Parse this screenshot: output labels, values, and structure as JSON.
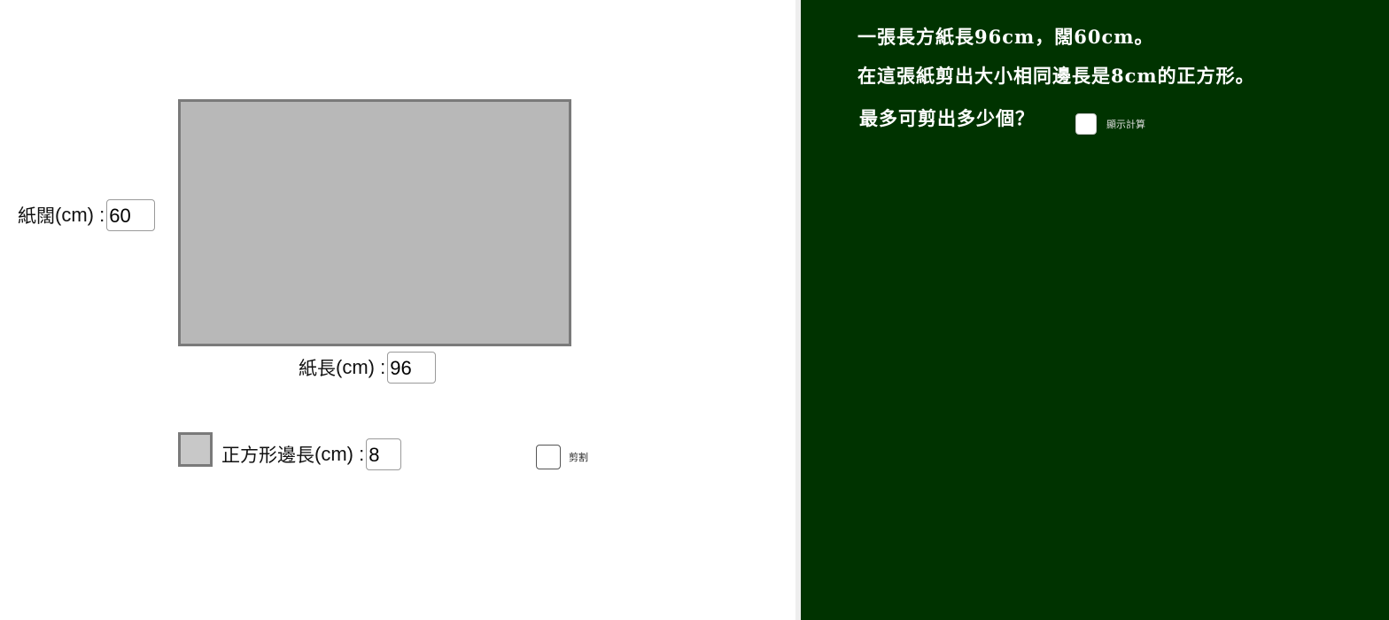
{
  "canvas": {
    "paper_width_label": "紙闊",
    "paper_width_unit": "(cm) :",
    "paper_width_value": "60",
    "paper_length_label": "紙長",
    "paper_length_unit": "(cm) :",
    "paper_length_value": "96",
    "square_side_label": "正方形邊長",
    "square_side_unit": "(cm) :",
    "square_side_value": "8",
    "cut_checkbox_label": "剪割",
    "colors": {
      "paper_fill": "#b8b8b8",
      "paper_border": "#7a7a7a",
      "square_fill": "#c8c8c8"
    }
  },
  "panel": {
    "question_line_1": "一張長方紙長96cm，闊60cm。",
    "question_line_2": "在這張紙剪出大小相同邊長是8cm的正方形。",
    "question_line_3": "最多可剪出多少個？",
    "show_calc_label": "顯示計算",
    "colors": {
      "background": "#003300",
      "text": "#ffffff"
    }
  }
}
